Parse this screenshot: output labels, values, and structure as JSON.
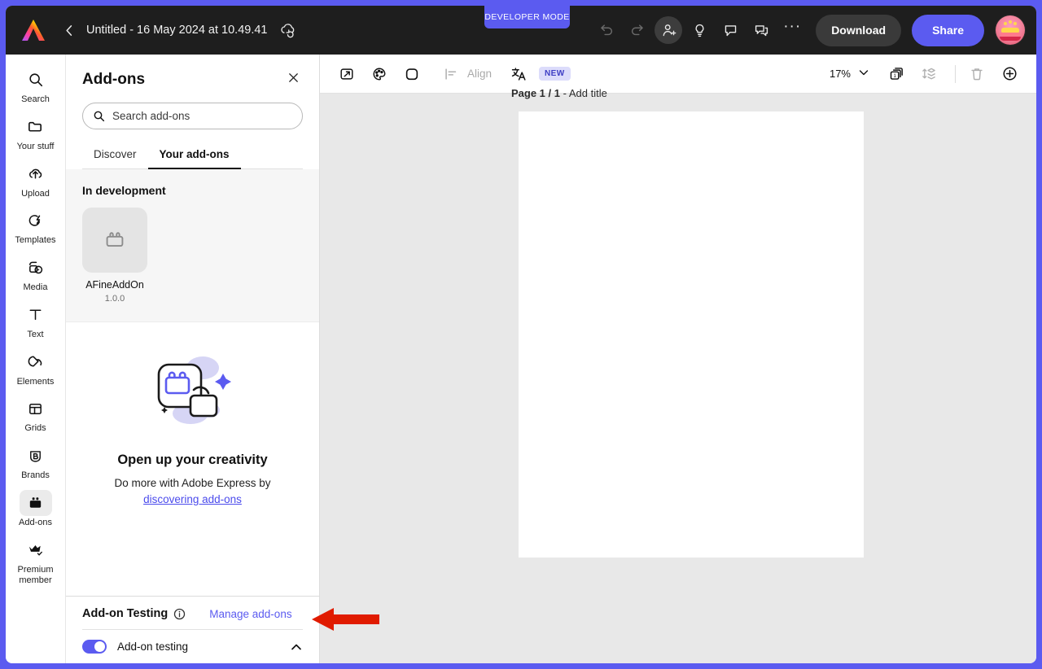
{
  "dev_badge": {
    "label": "DEVELOPER MODE",
    "color": "#5b5bf0"
  },
  "topbar": {
    "logo_icon": "adobe-express-logo",
    "back_icon": "chevron-left-icon",
    "doc_title": "Untitled - 16 May 2024 at 10.49.41",
    "cloud_icon": "cloud-sync-icon",
    "undo_icon": "undo-icon",
    "redo_icon": "redo-icon",
    "invite_icon": "add-person-icon",
    "ideas_icon": "lightbulb-icon",
    "comment_icon": "comment-icon",
    "chat_icon": "chat-bubbles-icon",
    "more_icon": "more-options-icon",
    "download_label": "Download",
    "share_label": "Share",
    "avatar_icon": "user-avatar-cake"
  },
  "rail": {
    "items": [
      {
        "label": "Search",
        "icon": "search-icon",
        "active": false
      },
      {
        "label": "Your stuff",
        "icon": "folder-icon",
        "active": false
      },
      {
        "label": "Upload",
        "icon": "upload-cloud-icon",
        "active": false
      },
      {
        "label": "Templates",
        "icon": "templates-icon",
        "active": false
      },
      {
        "label": "Media",
        "icon": "media-icon",
        "active": false
      },
      {
        "label": "Text",
        "icon": "text-icon",
        "active": false
      },
      {
        "label": "Elements",
        "icon": "elements-icon",
        "active": false
      },
      {
        "label": "Grids",
        "icon": "grids-icon",
        "active": false
      },
      {
        "label": "Brands",
        "icon": "brands-icon",
        "active": false
      },
      {
        "label": "Add-ons",
        "icon": "addons-icon",
        "active": true
      },
      {
        "label": "Premium member",
        "icon": "crown-icon",
        "active": false
      }
    ]
  },
  "panel": {
    "title": "Add-ons",
    "close_icon": "close-icon",
    "search": {
      "icon": "search-icon",
      "placeholder": "Search add-ons",
      "value": ""
    },
    "tabs": [
      {
        "label": "Discover",
        "active": false
      },
      {
        "label": "Your add-ons",
        "active": true
      }
    ],
    "in_development": {
      "heading": "In development",
      "addons": [
        {
          "name": "AFineAddOn",
          "version": "1.0.0",
          "icon": "addon-placeholder-icon"
        }
      ]
    },
    "empty_state": {
      "illustration": "addon-unlock-illustration",
      "title": "Open up your creativity",
      "subtitle": "Do more with Adobe Express by",
      "link": "discovering add-ons",
      "link_color": "#4b4bec"
    },
    "testing": {
      "title": "Add-on Testing",
      "info_icon": "info-icon",
      "manage_link": "Manage add-ons",
      "toggle_label": "Add-on testing",
      "toggle_on": true,
      "toggle_color": "#5b5bf0",
      "collapse_icon": "chevron-up-icon"
    }
  },
  "canvas": {
    "toolbar": {
      "resize_icon": "resize-icon",
      "palette_icon": "color-palette-icon",
      "shape_icon": "rounded-square-icon",
      "align_icon": "align-icon",
      "align_label": "Align",
      "translate_icon": "translate-icon",
      "new_badge": "NEW",
      "zoom_value": "17%",
      "zoom_caret_icon": "chevron-down-icon",
      "pages_icon": "pages-icon",
      "reorder_icon": "reorder-pages-icon",
      "delete_icon": "trash-icon",
      "add_icon": "add-page-icon"
    },
    "page_label_bold": "Page 1 / 1",
    "page_label_rest": "- Add title"
  },
  "annotation": {
    "arrow_icon": "red-arrow-left",
    "color": "#e01b00"
  }
}
